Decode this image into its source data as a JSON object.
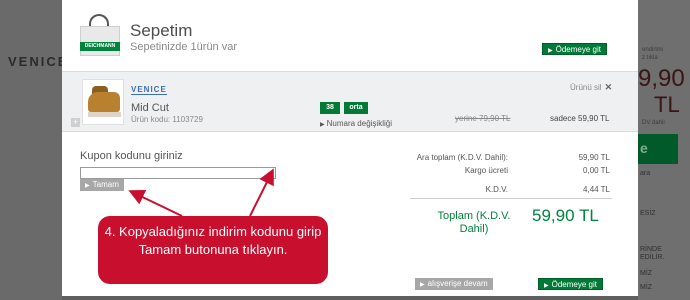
{
  "background": {
    "left_logo": "VENICE",
    "right_lines_top": [
      "endirimi",
      "z tıkla"
    ],
    "right_price": "9,90",
    "right_currency": "TL",
    "right_tax": "DV dahil",
    "right_button": "e",
    "right_misc": [
      "ara",
      "ESİZ",
      "RİNDE",
      "EDİLİR.",
      "MİZ",
      "MİZ"
    ]
  },
  "cart": {
    "title": "Sepetim",
    "subtitle": "Sepetinizde 1ürün var",
    "bag_label": "DEICHMANN",
    "checkout_top": "Ödemeye git",
    "checkout_bottom": "Ödemeye git",
    "continue_shopping": "alışverişe devam"
  },
  "product": {
    "brand": "VENICE",
    "name": "Mid Cut",
    "code": "Ürün kodu: 1103729",
    "size": "38",
    "width": "orta",
    "size_change": "Numara değişikliği",
    "remove": "Ürünü sil",
    "old_price": "yerine 79,90 TL",
    "new_price": "sadece 59,90 TL"
  },
  "coupon": {
    "label": "Kupon kodunu giriniz",
    "input_value": "",
    "apply": "Tamam"
  },
  "summary": {
    "subtotal_label": "Ara toplam (K.D.V. Dahil):",
    "subtotal_value": "59,90 TL",
    "shipping_label": "Kargo ücreti",
    "shipping_value": "0,00 TL",
    "vat_label": "K.D.V.",
    "vat_value": "4,44 TL",
    "total_label": "Toplam (K.D.V. Dahil)",
    "total_value": "59,90 TL"
  },
  "callout": {
    "text": "4. Kopyaladığınız indirim kodunu girip Tamam butonuna tıklayın."
  },
  "colors": {
    "brand_green": "#007a36",
    "callout_red": "#c8102e"
  }
}
